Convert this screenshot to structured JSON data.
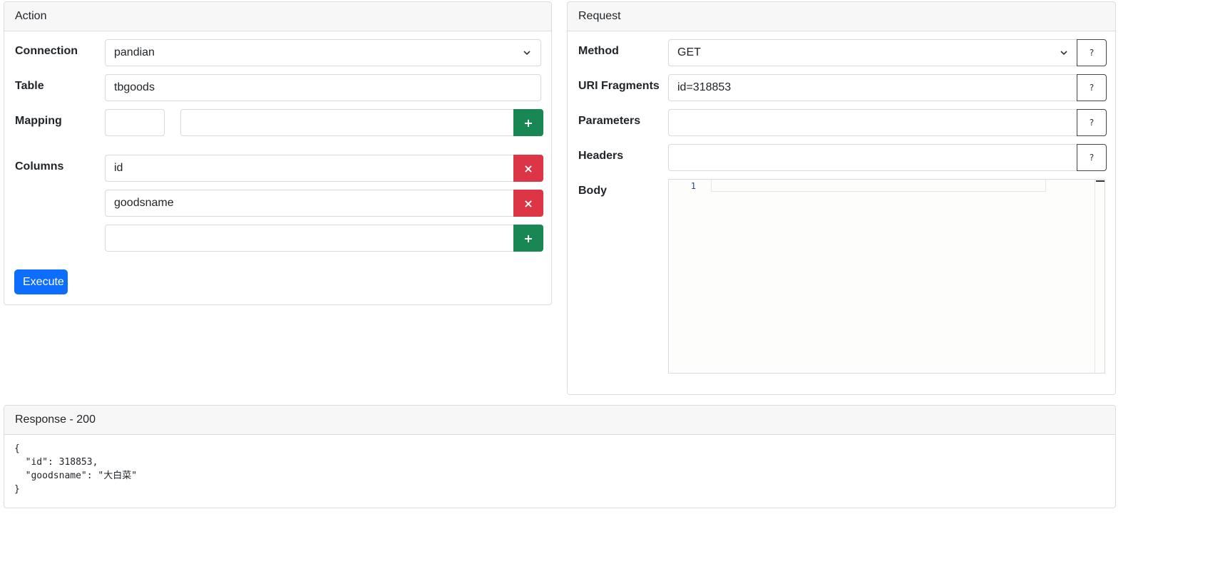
{
  "action": {
    "title": "Action",
    "connection_label": "Connection",
    "connection_value": "pandian",
    "table_label": "Table",
    "table_value": "tbgoods",
    "mapping_label": "Mapping",
    "mapping_key": "",
    "mapping_value": "",
    "columns_label": "Columns",
    "columns": [
      "id",
      "goodsname",
      ""
    ],
    "add_symbol": "+",
    "remove_symbol": "×",
    "execute_label": "Execute"
  },
  "request": {
    "title": "Request",
    "method_label": "Method",
    "method_value": "GET",
    "uri_label": "URI Fragments",
    "uri_value": "id=318853",
    "parameters_label": "Parameters",
    "parameters_value": "",
    "headers_label": "Headers",
    "headers_value": "",
    "body_label": "Body",
    "body_line_number": "1",
    "help_symbol": "?"
  },
  "response": {
    "title": "Response - 200",
    "lines": [
      "{",
      "  \"id\": 318853,",
      "  \"goodsname\": \"大白菜\"",
      "}"
    ]
  },
  "icons": {
    "select_arrow": "chevron-down-icon",
    "add": "plus-icon",
    "remove": "close-icon",
    "help": "question-icon"
  },
  "colors": {
    "add_button": "#198754",
    "remove_button": "#dc3545",
    "primary_button": "#0d6efd"
  }
}
